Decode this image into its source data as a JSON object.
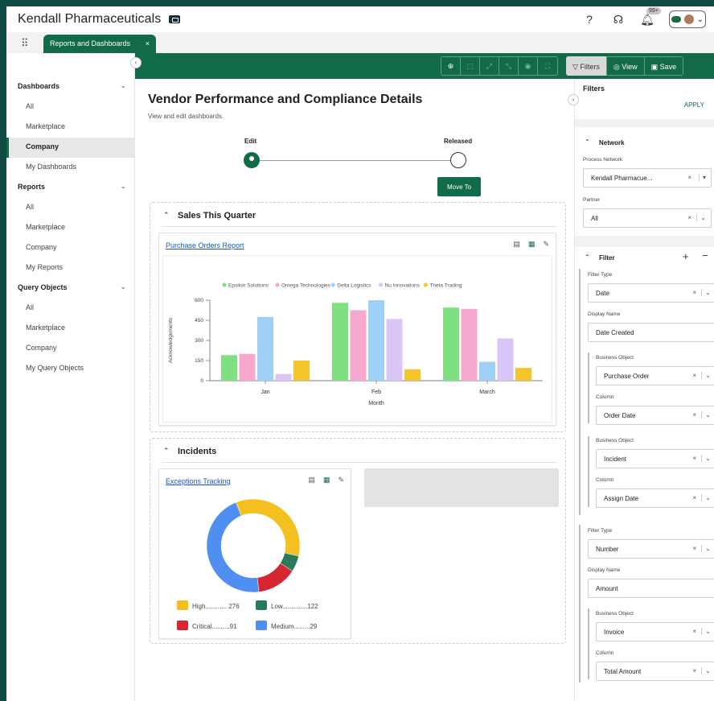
{
  "app": {
    "title": "Kendall Pharmaceuticals",
    "notifications_badge": "99+",
    "brand_color": "#126b48"
  },
  "tabs": [
    {
      "label": "Reports and Dashboards",
      "close": "×"
    }
  ],
  "sidebar": {
    "sections": [
      {
        "label": "Dashboards",
        "items": [
          "All",
          "Marketplace",
          "Company",
          "My Dashboards"
        ]
      },
      {
        "label": "Reports",
        "items": [
          "All",
          "Marketplace",
          "Company",
          "My Reports"
        ]
      },
      {
        "label": "Query Objects",
        "items": [
          "All",
          "Marketplace",
          "Company",
          "My Query Objects"
        ]
      }
    ],
    "active": "Dashboards/Company"
  },
  "toolbar": {
    "filters": "Filters",
    "view": "View",
    "save": "Save"
  },
  "page": {
    "title": "Vendor Performance and Compliance Details",
    "subtitle": "View and edit dashboards.",
    "step_edit": "Edit",
    "step_released": "Released",
    "move_to": "Move To"
  },
  "sales_panel": {
    "title": "Sales This Quarter",
    "report_link": "Purchase Orders Report"
  },
  "incidents_panel": {
    "title": "Incidents",
    "report_link": "Exceptions Tracking"
  },
  "chart_data": [
    {
      "type": "bar",
      "categories": [
        "Jan",
        "Feb",
        "March"
      ],
      "series": [
        {
          "name": "Epsilon Solutions",
          "color": "#7ee081",
          "values": [
            190,
            580,
            545
          ]
        },
        {
          "name": "Omega Technologies",
          "color": "#f7a8cf",
          "values": [
            200,
            525,
            535
          ]
        },
        {
          "name": "Delta Logistics",
          "color": "#9fd0f7",
          "values": [
            475,
            600,
            140
          ]
        },
        {
          "name": "Nu Innovations",
          "color": "#d9c6f7",
          "values": [
            50,
            460,
            315
          ]
        },
        {
          "name": "Theta Trading",
          "color": "#f6c52c",
          "values": [
            150,
            85,
            95
          ]
        }
      ],
      "xlabel": "Month",
      "ylabel": "Acknowledgements",
      "ylim": [
        0,
        600
      ],
      "yticks": [
        "0",
        "150",
        "300",
        "450",
        "600"
      ],
      "legend": "top"
    },
    {
      "type": "pie",
      "style": "donut",
      "slices": [
        {
          "label": "High",
          "value": 276,
          "color": "#f3c020",
          "legend_text": "High............ 276"
        },
        {
          "label": "Low",
          "value": 122,
          "color": "#2b7a5a",
          "legend_text": "Low..............122"
        },
        {
          "label": "Critical",
          "value": 91,
          "color": "#d62631",
          "legend_text": "Critical..........91"
        },
        {
          "label": "Medium",
          "value": 29,
          "color": "#4e8ff1",
          "legend_text": "Medium.........29"
        }
      ],
      "sweep_deg": [
        125,
        20,
        50,
        165
      ]
    }
  ],
  "filters_panel": {
    "title": "Filters",
    "apply": "APPLY",
    "network_header": "Network",
    "process_network_label": "Process Network",
    "process_network_value": "Kendall Pharmacue...",
    "partner_label": "Partner",
    "partner_value": "All",
    "filter_header": "Filter",
    "filter_type_label": "Filter Type",
    "display_name_label": "Display Name",
    "business_object_label": "Business Object",
    "column_label": "Column",
    "filter1": {
      "type": "Date",
      "display_name": "Date Created",
      "bo1": "Purchase Order",
      "col1": "Order Date",
      "bo2": "Incident",
      "col2": "Assign Date"
    },
    "filter2": {
      "type": "Number",
      "display_name": "Amount",
      "bo1": "Invoice",
      "col1": "Total Amount"
    }
  }
}
